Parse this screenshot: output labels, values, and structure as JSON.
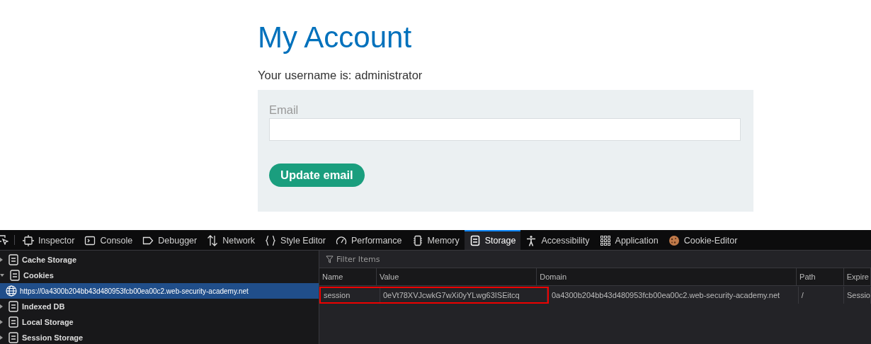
{
  "page": {
    "title": "My Account",
    "username_line": "Your username is: administrator",
    "email_label": "Email",
    "submit_button": "Update email"
  },
  "devtools": {
    "tabs": [
      {
        "label": "Inspector",
        "selected": false
      },
      {
        "label": "Console",
        "selected": false
      },
      {
        "label": "Debugger",
        "selected": false
      },
      {
        "label": "Network",
        "selected": false
      },
      {
        "label": "Style Editor",
        "selected": false
      },
      {
        "label": "Performance",
        "selected": false
      },
      {
        "label": "Memory",
        "selected": false
      },
      {
        "label": "Storage",
        "selected": true
      },
      {
        "label": "Accessibility",
        "selected": false
      },
      {
        "label": "Application",
        "selected": false
      },
      {
        "label": "Cookie-Editor",
        "selected": false
      }
    ],
    "tree": [
      {
        "label": "Cache Storage",
        "expanded": false,
        "selected": false
      },
      {
        "label": "Cookies",
        "expanded": true,
        "selected": false,
        "children": [
          {
            "label": "https://0a4300b204bb43d480953fcb00ea00c2.web-security-academy.net",
            "selected": true
          }
        ]
      },
      {
        "label": "Indexed DB",
        "expanded": false,
        "selected": false
      },
      {
        "label": "Local Storage",
        "expanded": false,
        "selected": false
      },
      {
        "label": "Session Storage",
        "expanded": false,
        "selected": false
      }
    ],
    "filter_placeholder": "Filter Items",
    "table": {
      "columns": [
        "Name",
        "Value",
        "Domain",
        "Path",
        "Expire"
      ],
      "rows": [
        {
          "cells": [
            "session",
            "0eVt78XVJcwkG7wXi0yYLwg63ISEitcq",
            "0a4300b204bb43d480953fcb00ea00c2.web-security-academy.net",
            "/",
            "Sessio"
          ],
          "highlighted": true
        }
      ]
    }
  }
}
